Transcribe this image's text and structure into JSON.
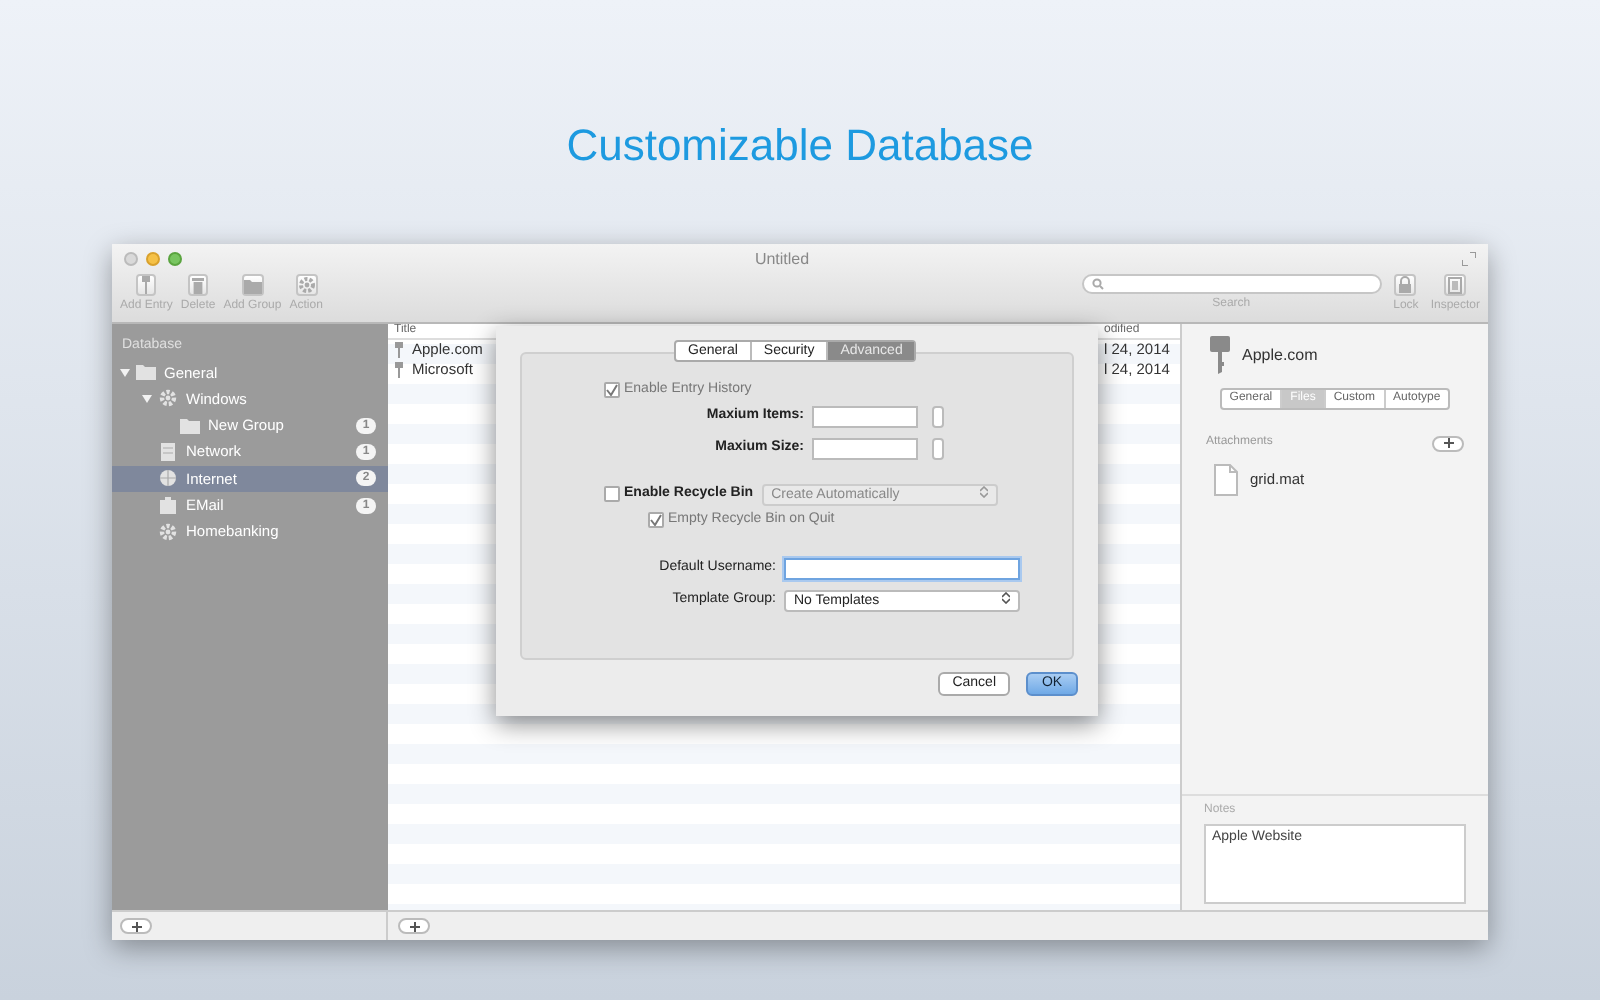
{
  "headline": "Customizable Database",
  "window": {
    "title": "Untitled"
  },
  "toolbar": {
    "buttons": [
      {
        "label": "Add Entry",
        "kind": "key"
      },
      {
        "label": "Delete",
        "kind": "trash"
      },
      {
        "label": "Add Group",
        "kind": "folder"
      },
      {
        "label": "Action",
        "kind": "gear"
      }
    ],
    "search_label": "Search",
    "right_buttons": [
      {
        "label": "Lock",
        "kind": "lock"
      },
      {
        "label": "Inspector",
        "kind": "panel"
      }
    ]
  },
  "sidebar": {
    "header": "Database",
    "items": [
      {
        "label": "General",
        "kind": "folder",
        "expanded": true,
        "selected": false,
        "children": [
          {
            "label": "Windows",
            "kind": "gear",
            "expanded": true,
            "selected": false,
            "children": [
              {
                "label": "New Group",
                "kind": "folder",
                "count": "1",
                "selected": false
              }
            ]
          },
          {
            "label": "Network",
            "kind": "server",
            "count": "1",
            "selected": false
          },
          {
            "label": "Internet",
            "kind": "globe",
            "count": "2",
            "selected": true
          },
          {
            "label": "EMail",
            "kind": "mail",
            "count": "1",
            "selected": false
          },
          {
            "label": "Homebanking",
            "kind": "gear",
            "selected": false
          }
        ]
      }
    ]
  },
  "table": {
    "columns": [
      "Title",
      "odified"
    ],
    "rows": [
      {
        "title": "Apple.com",
        "modified": "l 24, 2014"
      },
      {
        "title": "Microsoft",
        "modified": "l 24, 2014"
      }
    ]
  },
  "dialog": {
    "tabs": [
      {
        "label": "General",
        "selected": false
      },
      {
        "label": "Security",
        "selected": false
      },
      {
        "label": "Advanced",
        "selected": true
      }
    ],
    "enable_history": {
      "label": "Enable Entry History",
      "checked": true
    },
    "max_items": {
      "label": "Maxium Items:"
    },
    "max_size": {
      "label": "Maxium Size:"
    },
    "enable_recycle": {
      "label": "Enable Recycle Bin",
      "checked": false
    },
    "recycle_select": {
      "value": "Create Automatically"
    },
    "empty_on_quit": {
      "label": "Empty Recycle Bin on Quit",
      "checked": true
    },
    "default_username": {
      "label": "Default Username:"
    },
    "template_group": {
      "label": "Template Group:",
      "value": "No Templates"
    },
    "buttons": [
      {
        "label": "Cancel",
        "default": false
      },
      {
        "label": "OK",
        "default": true
      }
    ]
  },
  "inspector": {
    "title": "Apple.com",
    "tabs": [
      {
        "label": "General",
        "selected": false
      },
      {
        "label": "Files",
        "selected": true
      },
      {
        "label": "Custom",
        "selected": false
      },
      {
        "label": "Autotype",
        "selected": false
      }
    ],
    "attachments_label": "Attachments",
    "files": [
      "grid.mat"
    ],
    "notes_label": "Notes",
    "notes": "Apple Website"
  }
}
